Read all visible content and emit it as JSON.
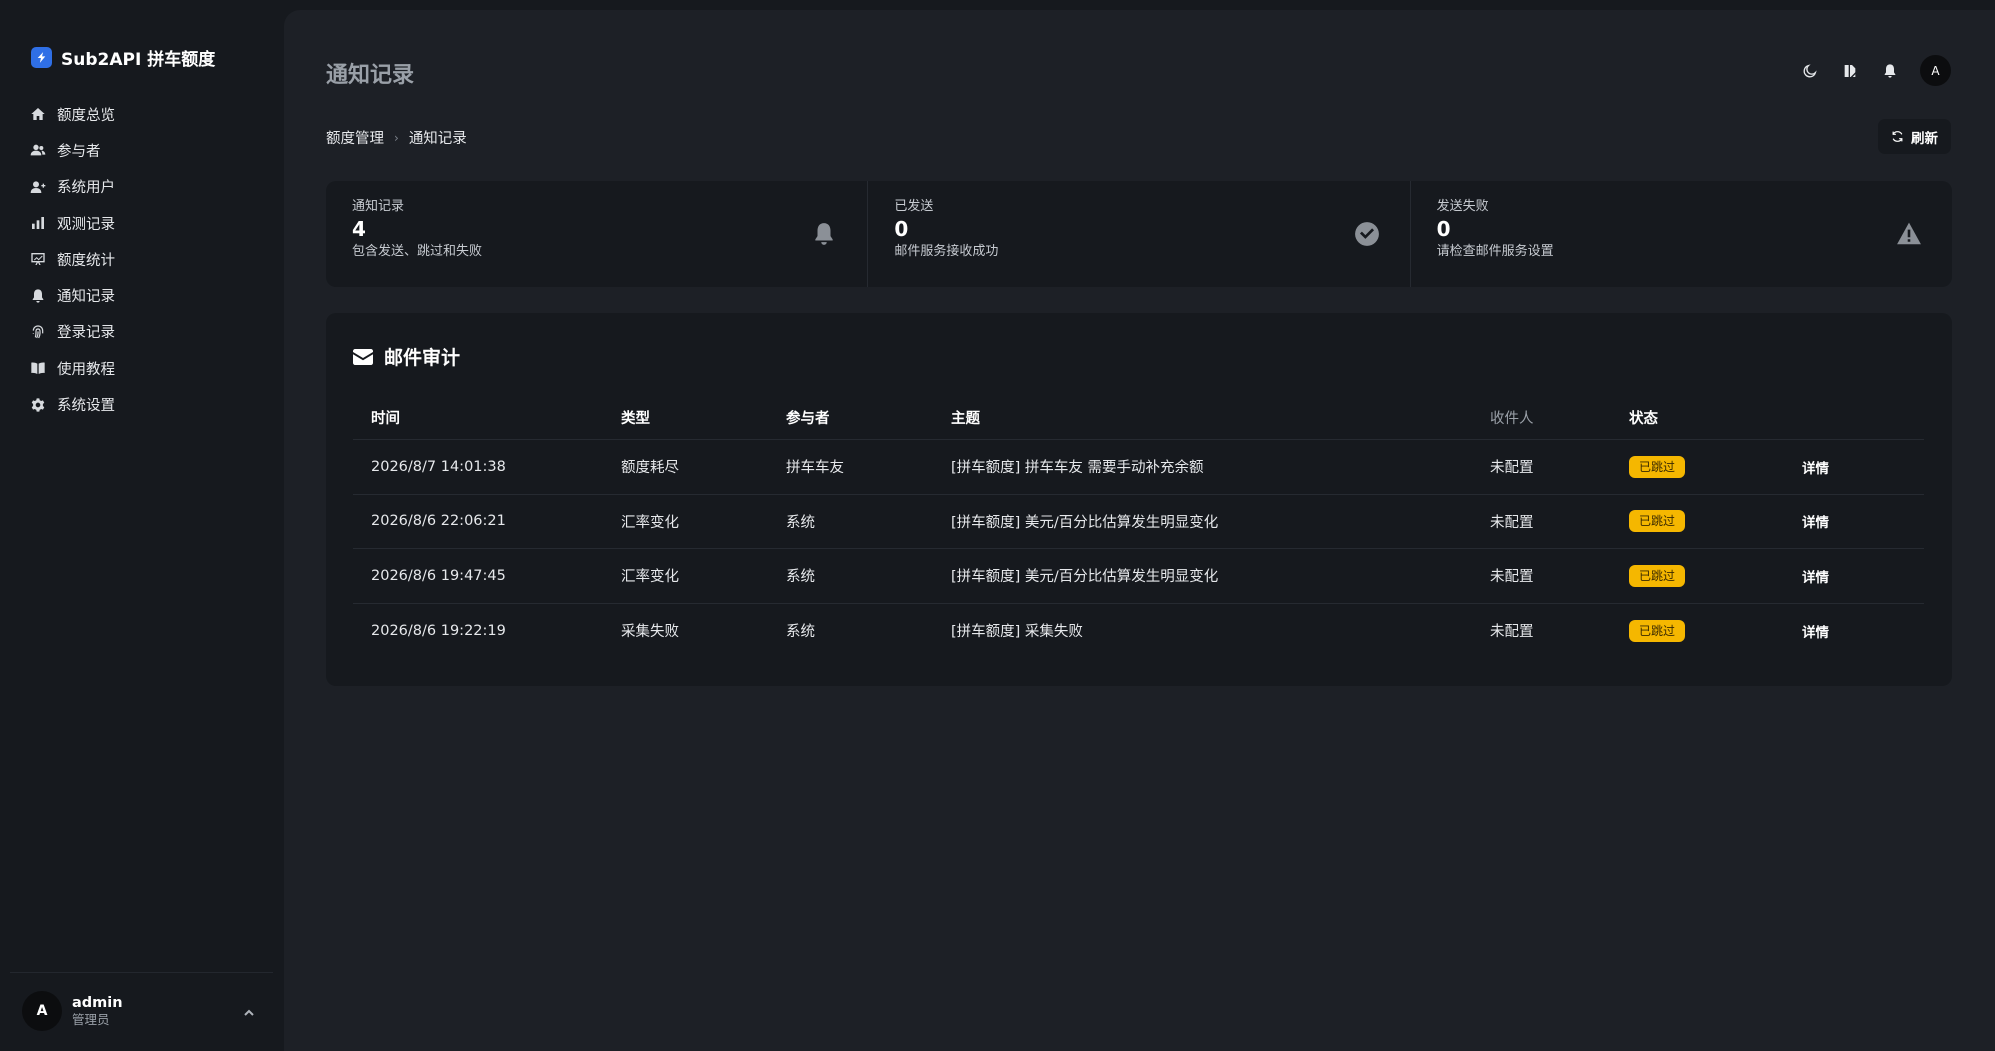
{
  "brand": {
    "name": "Sub2API 拼车额度"
  },
  "sidebar": {
    "items": [
      {
        "label": "额度总览",
        "icon": "home-icon"
      },
      {
        "label": "参与者",
        "icon": "users-icon"
      },
      {
        "label": "系统用户",
        "icon": "user-plus-icon"
      },
      {
        "label": "观测记录",
        "icon": "bar-chart-icon"
      },
      {
        "label": "额度统计",
        "icon": "chart-board-icon"
      },
      {
        "label": "通知记录",
        "icon": "bell-icon"
      },
      {
        "label": "登录记录",
        "icon": "fingerprint-icon"
      },
      {
        "label": "使用教程",
        "icon": "book-icon"
      },
      {
        "label": "系统设置",
        "icon": "gear-icon"
      }
    ]
  },
  "user": {
    "initial": "A",
    "name": "admin",
    "role": "管理员"
  },
  "header": {
    "title": "通知记录",
    "avatar_initial": "A",
    "breadcrumb": [
      "额度管理",
      "通知记录"
    ],
    "refresh_label": "刷新"
  },
  "stats": [
    {
      "label": "通知记录",
      "value": "4",
      "desc": "包含发送、跳过和失败",
      "icon": "bell-icon"
    },
    {
      "label": "已发送",
      "value": "0",
      "desc": "邮件服务接收成功",
      "icon": "check-circle-icon"
    },
    {
      "label": "发送失败",
      "value": "0",
      "desc": "请检查邮件服务设置",
      "icon": "warning-icon"
    }
  ],
  "audit": {
    "title": "邮件审计",
    "columns": [
      "时间",
      "类型",
      "参与者",
      "主题",
      "收件人",
      "状态"
    ],
    "rows": [
      {
        "time": "2026/8/7 14:01:38",
        "type": "额度耗尽",
        "participant": "拼车车友",
        "subject": "[拼车额度] 拼车车友 需要手动补充余额",
        "recipient": "未配置",
        "status": "已跳过",
        "action": "详情"
      },
      {
        "time": "2026/8/6 22:06:21",
        "type": "汇率变化",
        "participant": "系统",
        "subject": "[拼车额度] 美元/百分比估算发生明显变化",
        "recipient": "未配置",
        "status": "已跳过",
        "action": "详情"
      },
      {
        "time": "2026/8/6 19:47:45",
        "type": "汇率变化",
        "participant": "系统",
        "subject": "[拼车额度] 美元/百分比估算发生明显变化",
        "recipient": "未配置",
        "status": "已跳过",
        "action": "详情"
      },
      {
        "time": "2026/8/6 19:22:19",
        "type": "采集失败",
        "participant": "系统",
        "subject": "[拼车额度] 采集失败",
        "recipient": "未配置",
        "status": "已跳过",
        "action": "详情"
      }
    ]
  },
  "colors": {
    "accent": "#2f6fe6",
    "badge": "#f5b700",
    "background": "#16191e",
    "panel": "#1d2026"
  }
}
